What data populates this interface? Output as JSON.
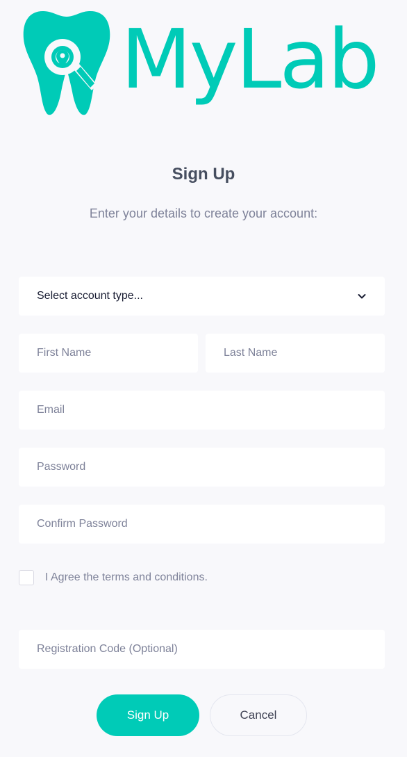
{
  "brand": {
    "name": "MyLab",
    "color": "#00cbb7",
    "logo_icon": "tooth-magnifier-icon"
  },
  "header": {
    "title": "Sign Up",
    "subtitle": "Enter your details to create your account:"
  },
  "form": {
    "account_type": {
      "selected": "Select account type...",
      "icon": "chevron-down-icon"
    },
    "first_name": {
      "placeholder": "First Name",
      "value": ""
    },
    "last_name": {
      "placeholder": "Last Name",
      "value": ""
    },
    "email": {
      "placeholder": "Email",
      "value": ""
    },
    "password": {
      "placeholder": "Password",
      "value": ""
    },
    "confirm_password": {
      "placeholder": "Confirm Password",
      "value": ""
    },
    "agree": {
      "label": "I Agree the terms and conditions.",
      "checked": false
    },
    "registration_code": {
      "placeholder": "Registration Code (Optional)",
      "value": ""
    }
  },
  "actions": {
    "signup_label": "Sign Up",
    "cancel_label": "Cancel"
  },
  "colors": {
    "accent": "#00cbb7",
    "background": "#f8f8fb",
    "title": "#464e5f",
    "muted": "#7e8299"
  }
}
